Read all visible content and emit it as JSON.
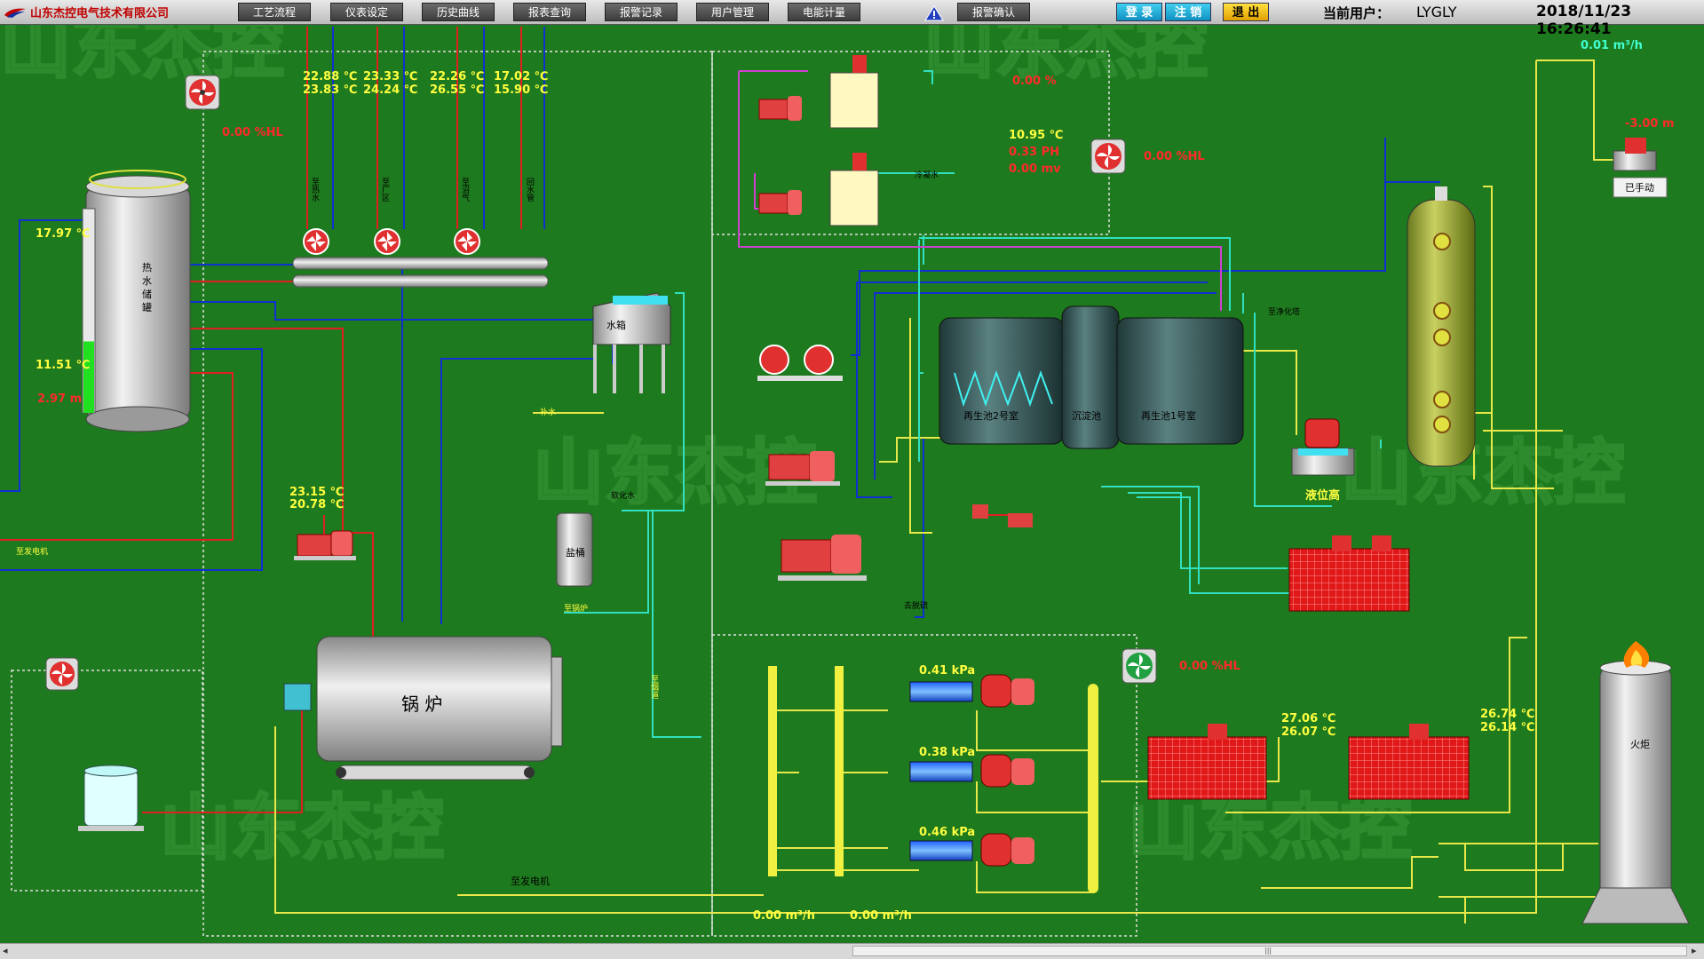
{
  "header": {
    "company": "山东杰控电气技术有限公司",
    "nav": [
      "工艺流程",
      "仪表设定",
      "历史曲线",
      "报表查询",
      "报警记录",
      "用户管理",
      "电能计量"
    ],
    "alarm_confirm": "报警确认",
    "login": "登 录",
    "logout_user": "注 销",
    "exit": "退 出",
    "user_label": "当前用户：",
    "user": "LYGLY",
    "datetime": "2018/11/23 16:26:41"
  },
  "colors": {
    "background": "#1e7a1e",
    "pipe_red": "#e02020",
    "pipe_blue": "#1030d0",
    "pipe_yellow": "#f0f040",
    "pipe_cyan": "#30e0c0",
    "pipe_purple": "#d040d0",
    "value_yellow": "#ffff40",
    "value_red": "#ff2a2a",
    "value_cyan": "#40ffd0"
  },
  "watermark": "山东杰控",
  "tank": {
    "label": "热水储罐",
    "temp_top": "17.97 ℃",
    "temp_mid": "11.51 ℃",
    "level": "2.97  m",
    "level_fraction": 0.35
  },
  "fan_left_top": {
    "value": "0.00  %HL"
  },
  "manifold": {
    "temps": [
      {
        "a": "22.88 ℃",
        "b": "23.83 ℃"
      },
      {
        "a": "23.33 ℃",
        "b": "24.24 ℃"
      },
      {
        "a": "22.26 ℃",
        "b": "26.55 ℃"
      },
      {
        "a": "17.02 ℃",
        "b": "15.90 ℃"
      }
    ],
    "pipe_labels": [
      "至热水",
      "至厂区",
      "至沼气",
      "回水管"
    ]
  },
  "water_tank": {
    "label": "水箱"
  },
  "salt_tank": {
    "label": "盐桶",
    "pipe_label": "软化水",
    "pipe_label2": "至锅炉"
  },
  "boiler": {
    "label": "锅  炉",
    "inlet_temp": "23.15 ℃",
    "outlet_temp": "20.78 ℃",
    "to_generator": "至发电机",
    "pipe_label": "补水",
    "flue": "至烟道"
  },
  "left_pipe_label": "至发电机",
  "dosing": {
    "value": "0.00  %"
  },
  "regen": {
    "temp": "10.95 ℃",
    "ph": "0.33  PH",
    "mv": "0.00  mv",
    "fan": "0.00  %HL",
    "label_1": "再生池2号室",
    "label_2": "沉淀池",
    "label_3": "再生池1号室",
    "pipe_label": "冷凝水",
    "pipe_label2": "去脱硫",
    "bottom_label": "至净化塔"
  },
  "tower": {
    "level_label": "液位高",
    "flow": "0.01   m³/h",
    "pressure": "-3.00   m",
    "mode": "已手动"
  },
  "compressors": [
    {
      "pressure": "0.41   kPa"
    },
    {
      "pressure": "0.38   kPa"
    },
    {
      "pressure": "0.46   kPa"
    }
  ],
  "flows": {
    "left": "0.00    m³/h",
    "right": "0.00    m³/h"
  },
  "fan_bottom": {
    "value": "0.00  %HL"
  },
  "generators": [
    {
      "t1": "27.06 ℃",
      "t2": "26.07 ℃"
    },
    {
      "t1": "26.74 ℃",
      "t2": "26.14 ℃"
    }
  ],
  "flare": {
    "label": "火炬"
  }
}
